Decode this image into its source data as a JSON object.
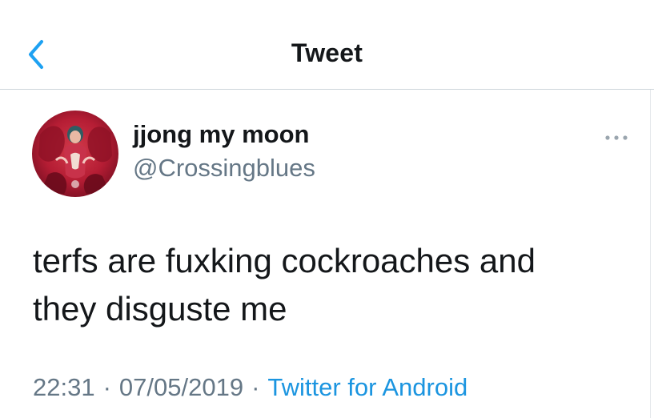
{
  "header": {
    "title": "Tweet",
    "back_icon": "chevron-left-icon",
    "accent_color": "#1da1f2"
  },
  "tweet": {
    "author": {
      "display_name": "jjong my moon",
      "handle": "@Crossingblues",
      "avatar": "avatar-image"
    },
    "more_icon": "more-horizontal-icon",
    "text_line_1": "terfs are fuxking cockroaches and",
    "text_line_2": "they disguste me",
    "time": "22:31",
    "date": "07/05/2019",
    "separator": "·",
    "source": "Twitter for Android"
  }
}
